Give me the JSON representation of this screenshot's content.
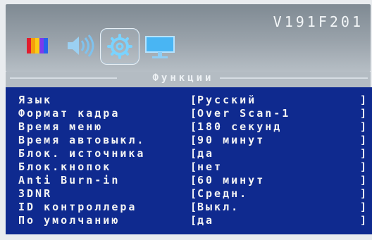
{
  "header": {
    "version": "V191F201",
    "icons": [
      {
        "name": "color-bars-icon",
        "selected": false
      },
      {
        "name": "speaker-icon",
        "selected": false
      },
      {
        "name": "gear-icon",
        "selected": true
      },
      {
        "name": "monitor-icon",
        "selected": false
      }
    ]
  },
  "section": {
    "title": "Функции"
  },
  "menu": {
    "items": [
      {
        "label": "Язык",
        "value": "Русский"
      },
      {
        "label": "Формат кадра",
        "value": "Over Scan-1"
      },
      {
        "label": "Время меню",
        "value": "180 секунд"
      },
      {
        "label": "Время автовыкл.",
        "value": "90 минут"
      },
      {
        "label": "Блок. источника",
        "value": "да"
      },
      {
        "label": "Блок.кнопок",
        "value": "нет"
      },
      {
        "label": "Anti Burn-in",
        "value": "60 минут"
      },
      {
        "label": "3DNR",
        "value": "Средн."
      },
      {
        "label": "ID контроллера",
        "value": "Выкл."
      },
      {
        "label": "По умолчанию",
        "value": "да"
      }
    ]
  },
  "colors": {
    "panel_bg": "#0f2a8f",
    "header_bg": "#8f99a1",
    "text": "#f4f4f4",
    "accent_blue": "#3aa3e6"
  }
}
